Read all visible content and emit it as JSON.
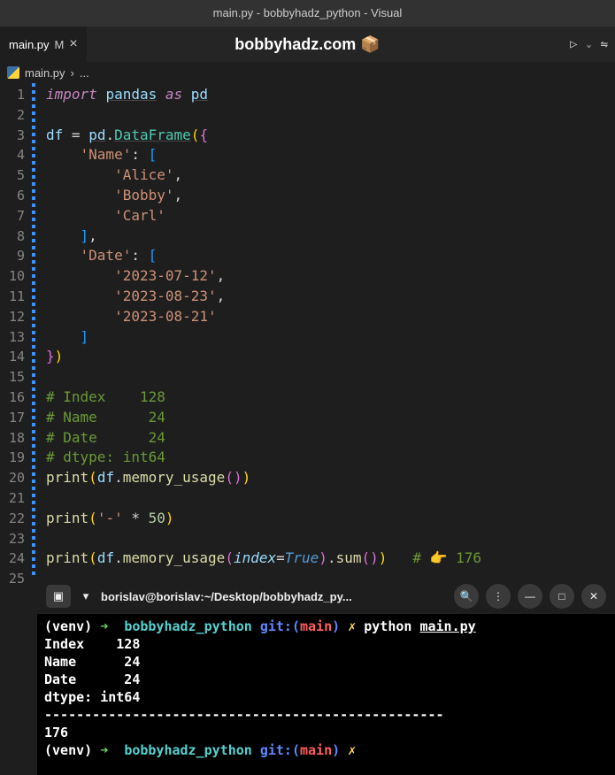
{
  "window": {
    "title": "main.py - bobbyhadz_python - Visual"
  },
  "tab": {
    "filename": "main.py",
    "modified_indicator": "M",
    "close": "×"
  },
  "site_label": "bobbyhadz.com 📦",
  "breadcrumb": {
    "file": "main.py",
    "sep": "›",
    "rest": "..."
  },
  "code": {
    "lines": 25,
    "imports": {
      "kw_import": "import",
      "module": "pandas",
      "kw_as": "as",
      "alias": "pd"
    },
    "assign": {
      "var": "df",
      "eq": "=",
      "pd": "pd",
      "dot": ".",
      "cls": "DataFrame"
    },
    "dict": {
      "key_name": "'Name'",
      "names": [
        "'Alice'",
        "'Bobby'",
        "'Carl'"
      ],
      "key_date": "'Date'",
      "dates": [
        "'2023-07-12'",
        "'2023-08-23'",
        "'2023-08-21'"
      ]
    },
    "comments": {
      "c1": "# Index    128",
      "c2": "# Name      24",
      "c3": "# Date      24",
      "c4": "# dtype: int64",
      "c5": "# 👉️ 176"
    },
    "calls": {
      "print": "print",
      "mem": "memory_usage",
      "sum": "sum",
      "dash": "'-'",
      "times": "*",
      "fifty": "50",
      "index_kw": "index",
      "true": "True"
    }
  },
  "terminal": {
    "header": {
      "title": "borislav@borislav:~/Desktop/bobbyhadz_py..."
    },
    "prompt": {
      "venv": "(venv)",
      "arrow": "➜",
      "dir": "bobbyhadz_python",
      "git_label": "git:(",
      "branch": "main",
      "git_close": ")",
      "dirty": "✗",
      "cmd_py": "python",
      "cmd_file": "main.py"
    },
    "output": {
      "l1": "Index    128",
      "l2": "Name      24",
      "l3": "Date      24",
      "l4": "dtype: int64",
      "l5": "--------------------------------------------------",
      "l6": "176"
    }
  }
}
